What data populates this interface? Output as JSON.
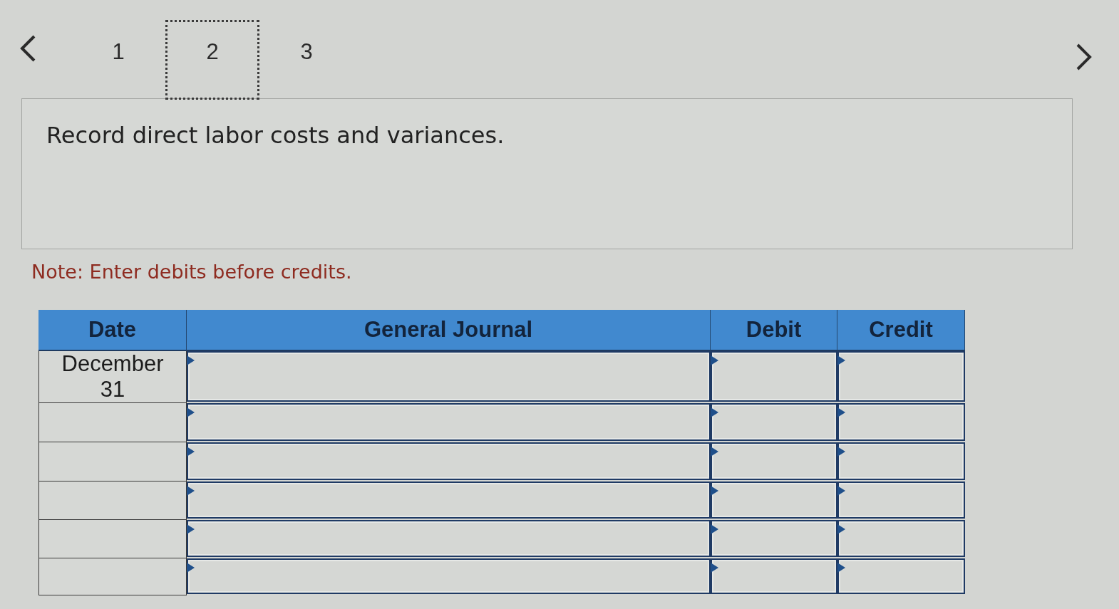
{
  "pager": {
    "pages": [
      {
        "label": "1",
        "selected": false
      },
      {
        "label": "2",
        "selected": true
      },
      {
        "label": "3",
        "selected": false
      }
    ]
  },
  "question": {
    "prompt": "Record direct labor costs and variances."
  },
  "note": "Note: Enter debits before credits.",
  "journal": {
    "columns": [
      "Date",
      "General Journal",
      "Debit",
      "Credit"
    ],
    "rows": [
      {
        "date": "December 31"
      },
      {},
      {},
      {},
      {},
      {}
    ]
  }
}
